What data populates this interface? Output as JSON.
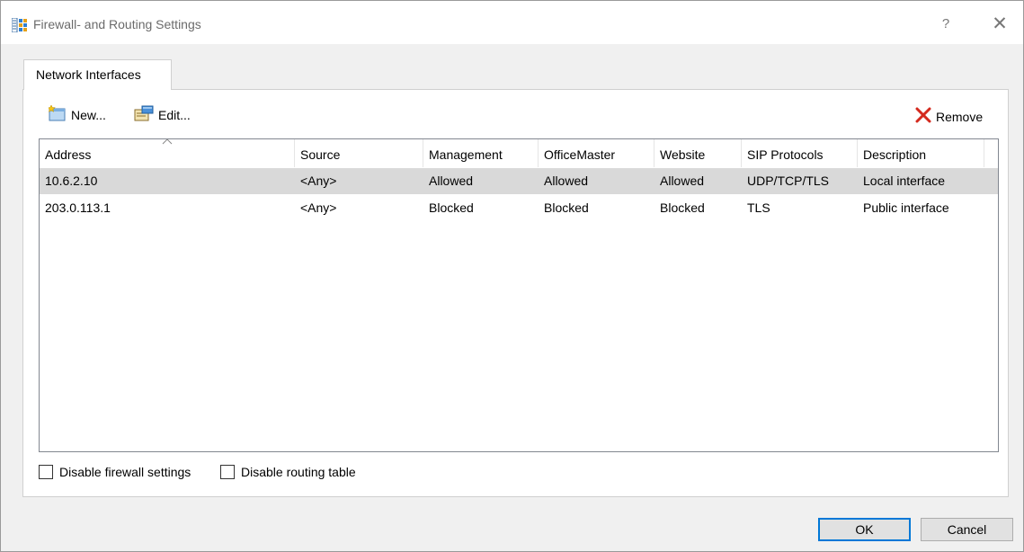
{
  "window": {
    "title": "Firewall- and Routing Settings",
    "help_label": "?",
    "close_label": "✕"
  },
  "tabs": [
    {
      "label": "Network Interfaces",
      "active": true
    }
  ],
  "toolbar": {
    "new_label": "New...",
    "edit_label": "Edit...",
    "remove_label": "Remove"
  },
  "table": {
    "columns": [
      "Address",
      "Source",
      "Management",
      "OfficeMaster",
      "Website",
      "SIP Protocols",
      "Description"
    ],
    "sort_indicator": "^",
    "rows": [
      {
        "selected": true,
        "cells": [
          "10.6.2.10",
          "<Any>",
          "Allowed",
          "Allowed",
          "Allowed",
          "UDP/TCP/TLS",
          "Local interface"
        ]
      },
      {
        "selected": false,
        "cells": [
          "203.0.113.1",
          "<Any>",
          "Blocked",
          "Blocked",
          "Blocked",
          "TLS",
          "Public interface"
        ]
      }
    ]
  },
  "options": {
    "disable_firewall_label": "Disable firewall settings",
    "disable_firewall_checked": false,
    "disable_routing_label": "Disable routing table",
    "disable_routing_checked": false
  },
  "buttons": {
    "ok_label": "OK",
    "cancel_label": "Cancel"
  },
  "colors": {
    "selection": "#d9d9d9",
    "default_button_border": "#0078d7",
    "remove_icon": "#d42a1e"
  }
}
